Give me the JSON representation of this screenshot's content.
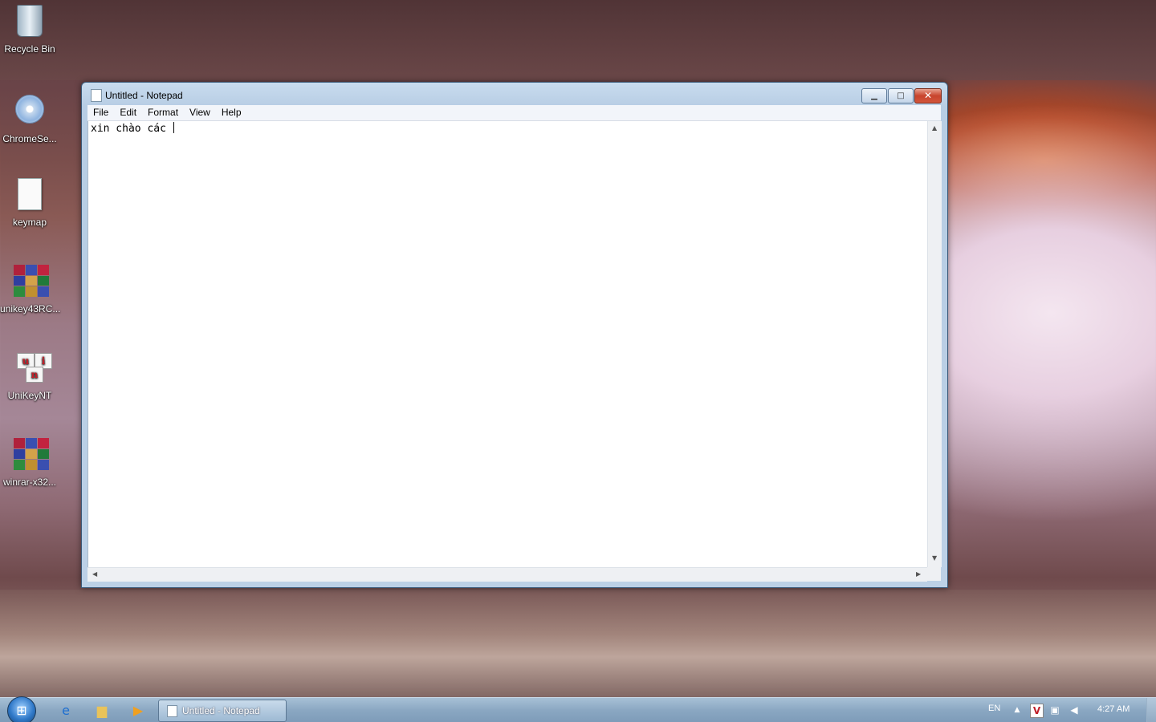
{
  "desktop": {
    "icons": [
      {
        "label": "Recycle Bin",
        "icon": "recycle-bin-icon"
      },
      {
        "label": "ChromeSe...",
        "icon": "setup-disc-icon"
      },
      {
        "label": "keymap",
        "icon": "text-document-icon"
      },
      {
        "label": "unikey43RC...",
        "icon": "winrar-archive-icon"
      },
      {
        "label": "UniKeyNT",
        "icon": "unikey-icon"
      },
      {
        "label": "winrar-x32...",
        "icon": "winrar-archive-icon"
      }
    ]
  },
  "notepad": {
    "title": "Untitled - Notepad",
    "menu": [
      "File",
      "Edit",
      "Format",
      "View",
      "Help"
    ],
    "content": "xin chào các "
  },
  "taskbar": {
    "pinned": [
      {
        "name": "internet-explorer-icon"
      },
      {
        "name": "file-explorer-icon"
      },
      {
        "name": "media-player-icon"
      }
    ],
    "active_task": "Untitled - Notepad",
    "language": "EN",
    "clock": "4:27 AM"
  },
  "colors": {
    "titlebar": "#c9dcef",
    "close_button": "#c8442c",
    "taskbar": "#8aa7c2"
  }
}
